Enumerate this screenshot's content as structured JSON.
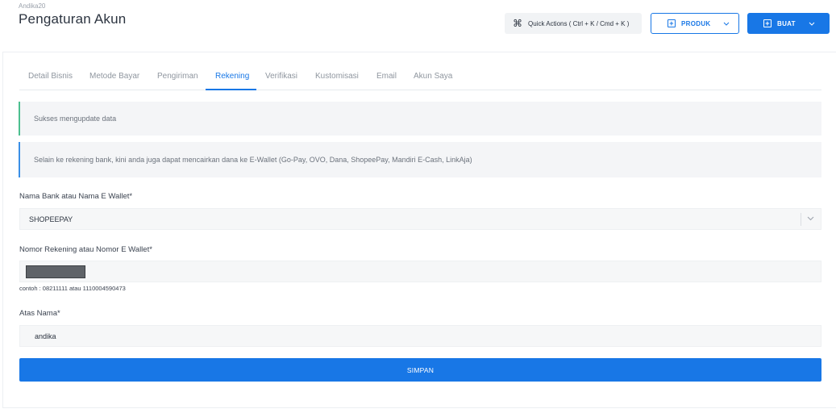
{
  "header": {
    "username": "Andika20",
    "title": "Pengaturan Akun",
    "quick_actions_label": "Quick Actions ( Ctrl + K / Cmd + K )",
    "produk_label": "PRODUK",
    "buat_label": "BUAT"
  },
  "tabs": [
    {
      "label": "Detail Bisnis",
      "active": false
    },
    {
      "label": "Metode Bayar",
      "active": false
    },
    {
      "label": "Pengiriman",
      "active": false
    },
    {
      "label": "Rekening",
      "active": true
    },
    {
      "label": "Verifikasi",
      "active": false
    },
    {
      "label": "Kustomisasi",
      "active": false
    },
    {
      "label": "Email",
      "active": false
    },
    {
      "label": "Akun Saya",
      "active": false
    }
  ],
  "alerts": {
    "success": "Sukses mengupdate data",
    "info": "Selain ke rekening bank, kini anda juga dapat mencairkan dana ke E-Wallet (Go-Pay, OVO, Dana, ShopeePay, Mandiri E-Cash, LinkAja)"
  },
  "form": {
    "bank_label": "Nama Bank atau Nama E Wallet*",
    "bank_value": "SHOPEEPAY",
    "rekening_label": "Nomor Rekening atau Nomor E Wallet*",
    "rekening_hint": "contoh : 08211111 atau 1110004590473",
    "nama_label": "Atas Nama*",
    "nama_value": "andika",
    "save_label": "SIMPAN"
  },
  "colors": {
    "primary": "#1877e6",
    "success_border": "#4cbf8f",
    "info_border": "#3b8fe6"
  }
}
